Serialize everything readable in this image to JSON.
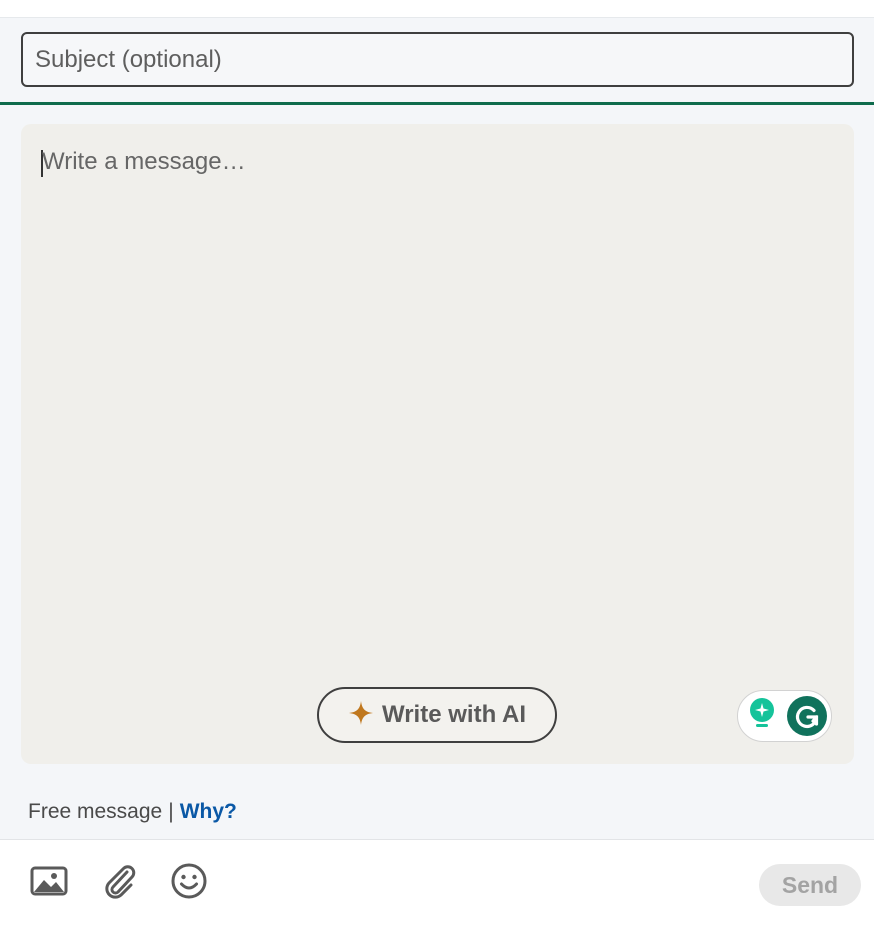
{
  "subject": {
    "placeholder": "Subject (optional)",
    "value": ""
  },
  "message": {
    "placeholder": "Write a message…"
  },
  "ai": {
    "label": "Write with AI"
  },
  "grammarly": {
    "icons": [
      "lightbulb-icon",
      "grammarly-g-icon"
    ]
  },
  "footer": {
    "note": "Free message",
    "separator": "|",
    "link": "Why?"
  },
  "toolbar": {
    "icons": [
      "image-icon",
      "paperclip-icon",
      "emoji-icon"
    ],
    "send_label": "Send"
  },
  "colors": {
    "accent_green": "#0e6b4c",
    "link_blue": "#0a58a6",
    "ai_sparkle": "#c0781e",
    "grammarly_green": "#10725c",
    "grammarly_teal": "#15c39a"
  }
}
